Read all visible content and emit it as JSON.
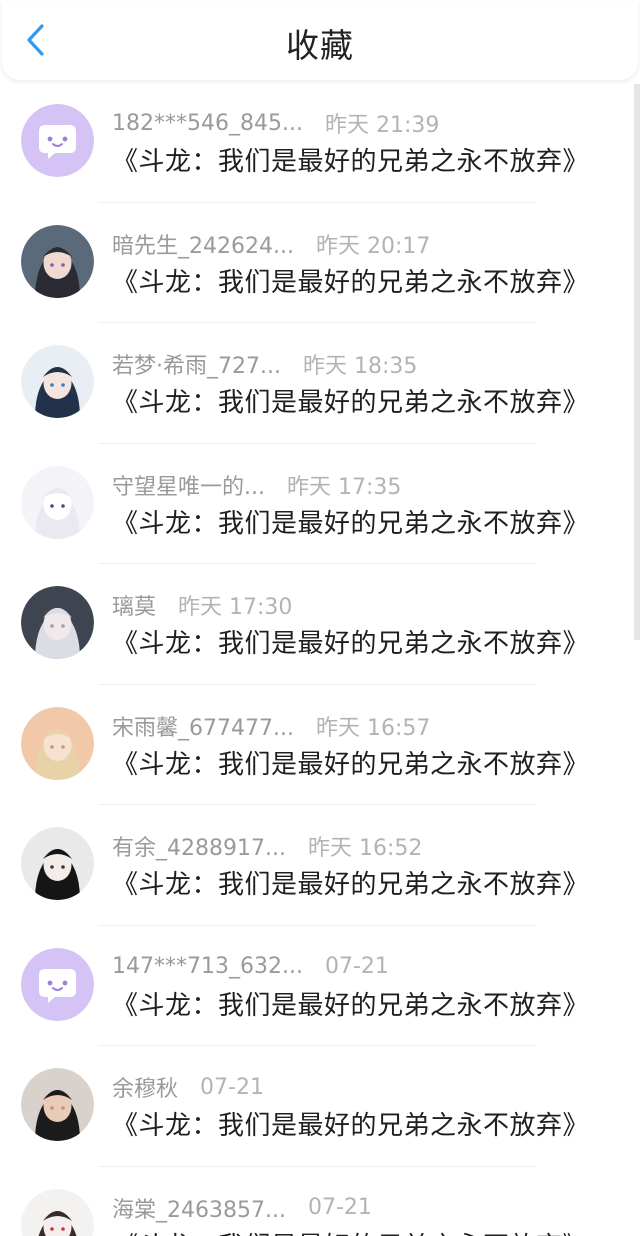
{
  "header": {
    "title": "收藏",
    "back_icon": "chevron-left-icon",
    "accent_color": "#2f9bf0"
  },
  "items": [
    {
      "name": "182***546_845...",
      "time": "昨天 21:39",
      "title": "《斗龙：我们是最好的兄弟之永不放弃》",
      "avatar": "default"
    },
    {
      "name": "暗先生_242624...",
      "time": "昨天 20:17",
      "title": "《斗龙：我们是最好的兄弟之永不放弃》",
      "avatar": "photo"
    },
    {
      "name": "若梦·希雨_727...",
      "time": "昨天 18:35",
      "title": "《斗龙：我们是最好的兄弟之永不放弃》",
      "avatar": "photo"
    },
    {
      "name": "守望星唯一的...",
      "time": "昨天 17:35",
      "title": "《斗龙：我们是最好的兄弟之永不放弃》",
      "avatar": "photo"
    },
    {
      "name": "璃莫",
      "time": "昨天 17:30",
      "title": "《斗龙：我们是最好的兄弟之永不放弃》",
      "avatar": "photo"
    },
    {
      "name": "宋雨馨_677477...",
      "time": "昨天 16:57",
      "title": "《斗龙：我们是最好的兄弟之永不放弃》",
      "avatar": "photo"
    },
    {
      "name": "有余_4288917...",
      "time": "昨天 16:52",
      "title": "《斗龙：我们是最好的兄弟之永不放弃》",
      "avatar": "photo"
    },
    {
      "name": "147***713_632...",
      "time": "07-21",
      "title": "《斗龙：我们是最好的兄弟之永不放弃》",
      "avatar": "default"
    },
    {
      "name": "余穆秋",
      "time": "07-21",
      "title": "《斗龙：我们是最好的兄弟之永不放弃》",
      "avatar": "photo"
    },
    {
      "name": "海棠_2463857...",
      "time": "07-21",
      "title": "《斗龙：我们是最好的兄弟之永不放弃》",
      "avatar": "photo"
    }
  ]
}
